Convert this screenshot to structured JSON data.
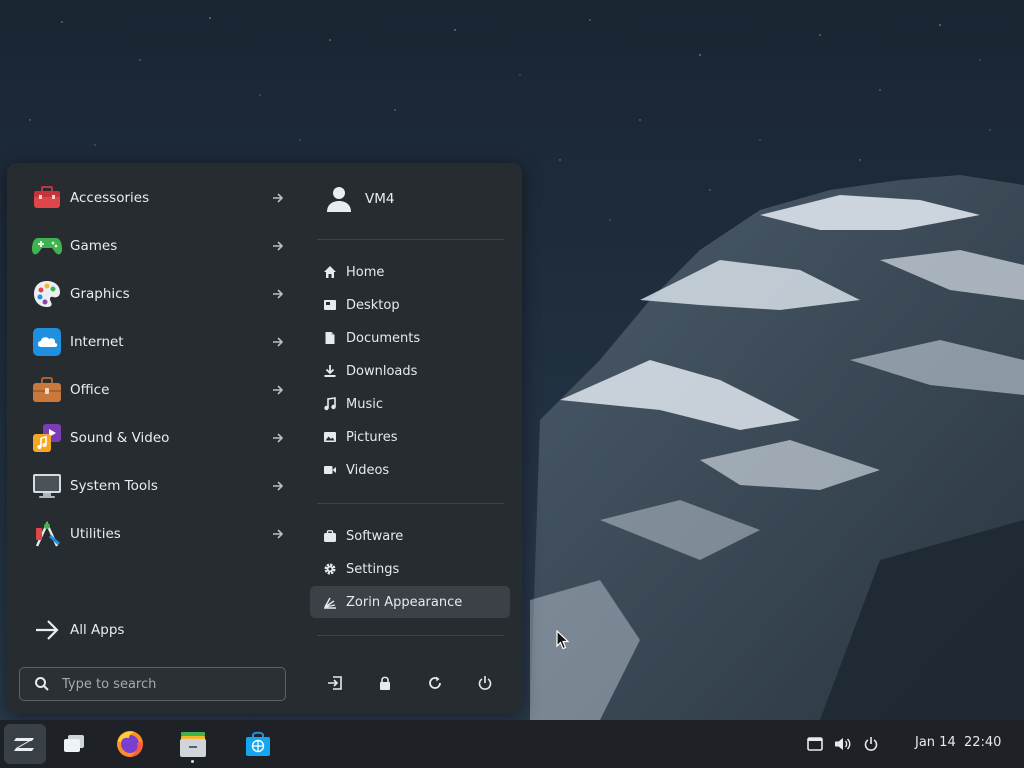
{
  "menu": {
    "categories": [
      {
        "label": "Accessories",
        "icon": "toolbox-icon"
      },
      {
        "label": "Games",
        "icon": "gamepad-icon"
      },
      {
        "label": "Graphics",
        "icon": "palette-icon"
      },
      {
        "label": "Internet",
        "icon": "cloud-icon"
      },
      {
        "label": "Office",
        "icon": "briefcase-icon"
      },
      {
        "label": "Sound & Video",
        "icon": "media-icon"
      },
      {
        "label": "System Tools",
        "icon": "monitor-icon"
      },
      {
        "label": "Utilities",
        "icon": "utilities-icon"
      }
    ],
    "all_apps_label": "All Apps",
    "search_placeholder": "Type to search",
    "user_name": "VM4",
    "places": [
      {
        "label": "Home",
        "icon": "home-icon"
      },
      {
        "label": "Desktop",
        "icon": "desktop-icon"
      },
      {
        "label": "Documents",
        "icon": "document-icon"
      },
      {
        "label": "Downloads",
        "icon": "download-icon"
      },
      {
        "label": "Music",
        "icon": "music-icon"
      },
      {
        "label": "Pictures",
        "icon": "pictures-icon"
      },
      {
        "label": "Videos",
        "icon": "video-icon"
      }
    ],
    "system": [
      {
        "label": "Software",
        "icon": "software-icon"
      },
      {
        "label": "Settings",
        "icon": "gear-icon"
      },
      {
        "label": "Zorin Appearance",
        "icon": "appearance-icon",
        "selected": true
      }
    ],
    "power_buttons": [
      "logout-icon",
      "lock-icon",
      "restart-icon",
      "power-icon"
    ]
  },
  "taskbar": {
    "apps": [
      "zorin-menu-icon",
      "workspaces-icon",
      "firefox-icon",
      "files-icon",
      "software-store-icon"
    ],
    "clock": {
      "date": "Jan 14",
      "time": "22:40"
    }
  },
  "colors": {
    "menu_bg": "#272c31",
    "taskbar_bg": "#1e2227",
    "accent_blue": "#15a6f0",
    "selected_bg": "#3b4147"
  }
}
